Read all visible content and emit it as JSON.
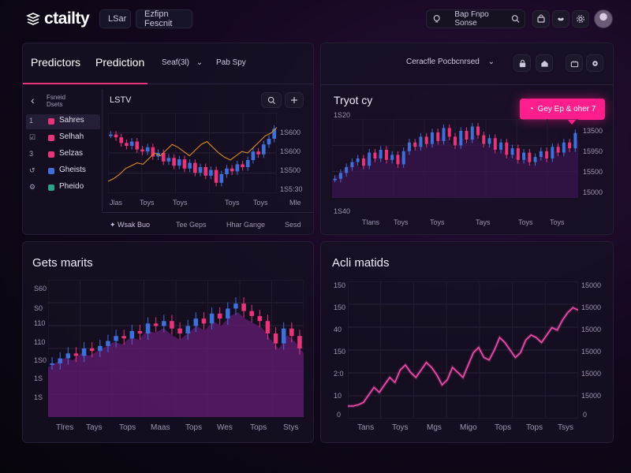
{
  "header": {
    "brand": "ctailty",
    "nav_button_1": "LSar",
    "nav_button_2": "Ezfipn Fescnit",
    "search_text": "Bap Fnpo Sonse"
  },
  "top_left": {
    "tab_predictors": "Predictors",
    "tab_prediction": "Prediction",
    "dropdown": "Seaf(3l)",
    "sort_label": "Pab Spy",
    "sidebar_title": "Fsneid Dsets",
    "sidebar_items": [
      {
        "num": "1",
        "label": "Sahres",
        "color": "#e8347a"
      },
      {
        "num": "☑",
        "label": "Selhah",
        "color": "#e8347a"
      },
      {
        "num": "3",
        "label": "Selzas",
        "color": "#e8347a"
      },
      {
        "num": "↺",
        "label": "Gheists",
        "color": "#3f6fd8"
      },
      {
        "num": "⚙",
        "label": "Pheido",
        "color": "#2aa38c"
      }
    ],
    "chart_title": "LSTV",
    "x_labels": [
      "Jlas",
      "Toys",
      "Toys",
      "Toys",
      "Toys",
      "Mle"
    ],
    "y_labels": [
      "1S600",
      "1S600",
      "1S500",
      "1S5:30"
    ],
    "footer_tabs": [
      "Wsak Buo",
      "Tee Geps",
      "Hhar Gange",
      "Sesd"
    ]
  },
  "top_right": {
    "dropdown": "Ceracfle Pocbcnrsed",
    "title": "Tryot cy",
    "cta_button": "Gey Ep & oher 7",
    "y_labels_left": [
      "1S20",
      "1S40"
    ],
    "y_labels_right": [
      "13500",
      "15950",
      "15500",
      "15000"
    ],
    "x_labels": [
      "Tlans",
      "Toys",
      "Toys",
      "Tays",
      "Toys",
      "Toys"
    ]
  },
  "bottom_left": {
    "title": "Gets marits",
    "y_labels": [
      "S60",
      "S0",
      "110",
      "110",
      "1S0",
      "1S",
      "1S"
    ],
    "x_labels": [
      "Tlres",
      "Tays",
      "Tops",
      "Maas",
      "Tops",
      "Wes",
      "Tops",
      "Stys"
    ]
  },
  "bottom_right": {
    "title": "Acli matids",
    "y_labels_left": [
      "150",
      "150",
      "40",
      "150",
      "2:0",
      "10",
      "0"
    ],
    "y_labels_right": [
      "15000",
      "15000",
      "15000",
      "15000",
      "15000",
      "15000",
      "0"
    ],
    "x_labels": [
      "Tans",
      "Toys",
      "Mgs",
      "Migo",
      "Tops",
      "Tops",
      "Tsys"
    ]
  },
  "chart_data": [
    {
      "type": "candlestick",
      "title": "LSTV",
      "close": [
        0.76,
        0.72,
        0.64,
        0.6,
        0.66,
        0.55,
        0.52,
        0.58,
        0.45,
        0.5,
        0.38,
        0.43,
        0.32,
        0.41,
        0.28,
        0.36,
        0.22,
        0.3,
        0.18,
        0.26,
        0.08,
        0.2,
        0.28,
        0.24,
        0.34,
        0.3,
        0.4,
        0.52,
        0.48,
        0.62,
        0.7,
        0.84
      ],
      "overlay_line": [
        0.1,
        0.14,
        0.2,
        0.28,
        0.32,
        0.36,
        0.34,
        0.42,
        0.5,
        0.46,
        0.54,
        0.62,
        0.58,
        0.52,
        0.46,
        0.54,
        0.62,
        0.66,
        0.58,
        0.5,
        0.44,
        0.4,
        0.46,
        0.52,
        0.5,
        0.58,
        0.66,
        0.74,
        0.78,
        0.86
      ]
    },
    {
      "type": "candlestick",
      "title": "Tryot cy",
      "close": [
        0.22,
        0.3,
        0.38,
        0.45,
        0.5,
        0.4,
        0.58,
        0.5,
        0.62,
        0.48,
        0.55,
        0.42,
        0.6,
        0.72,
        0.66,
        0.8,
        0.7,
        0.86,
        0.74,
        0.92,
        0.8,
        0.68,
        0.88,
        0.76,
        0.94,
        0.82,
        0.7,
        0.78,
        0.62,
        0.72,
        0.55,
        0.64,
        0.48,
        0.58,
        0.45,
        0.52,
        0.6,
        0.5,
        0.66,
        0.58,
        0.72,
        0.64,
        0.85
      ]
    },
    {
      "type": "area",
      "title": "Gets marits",
      "values": [
        0.38,
        0.42,
        0.46,
        0.44,
        0.5,
        0.48,
        0.52,
        0.56,
        0.6,
        0.58,
        0.64,
        0.62,
        0.7,
        0.68,
        0.72,
        0.66,
        0.62,
        0.68,
        0.74,
        0.7,
        0.78,
        0.74,
        0.82,
        0.86,
        0.8,
        0.76,
        0.72,
        0.62,
        0.54,
        0.66,
        0.6,
        0.5
      ]
    },
    {
      "type": "line",
      "title": "Acli matids",
      "values": [
        0.05,
        0.05,
        0.06,
        0.08,
        0.14,
        0.2,
        0.16,
        0.22,
        0.28,
        0.24,
        0.34,
        0.38,
        0.32,
        0.28,
        0.34,
        0.4,
        0.36,
        0.3,
        0.22,
        0.26,
        0.36,
        0.32,
        0.28,
        0.38,
        0.48,
        0.52,
        0.44,
        0.42,
        0.5,
        0.6,
        0.56,
        0.5,
        0.44,
        0.48,
        0.58,
        0.62,
        0.6,
        0.56,
        0.62,
        0.68,
        0.66,
        0.74,
        0.8,
        0.84,
        0.82
      ]
    }
  ],
  "colors": {
    "accent": "#e8347a",
    "bull": "#3f6fd8",
    "area_fill": "#5a1a6a",
    "line_pink": "#ff4fb3",
    "overlay": "#d98a22",
    "cta": "#ff1e8c"
  }
}
